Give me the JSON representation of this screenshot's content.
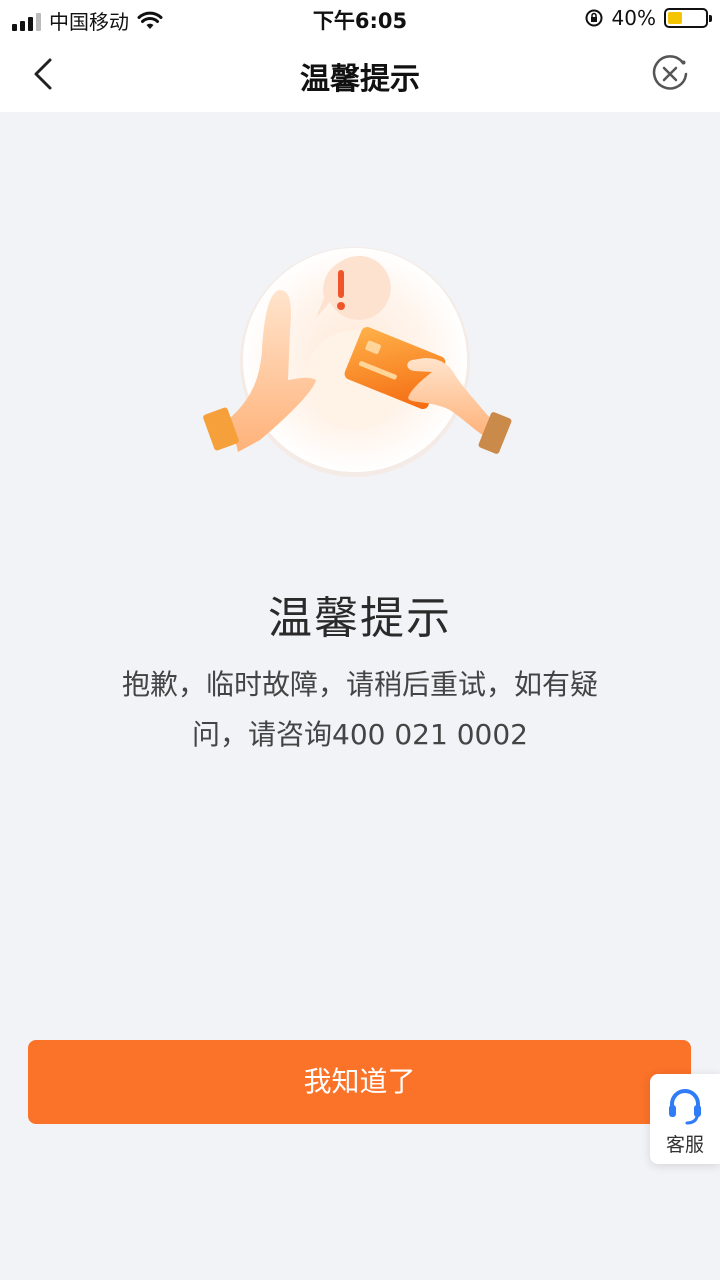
{
  "status_bar": {
    "carrier": "中国移动",
    "time": "下午6:05",
    "battery": "40%",
    "battery_level": 0.4
  },
  "nav": {
    "title": "温馨提示",
    "back_icon": "chevron-left-icon",
    "close_icon": "close-circle-icon"
  },
  "content": {
    "title": "温馨提示",
    "message_line1": "抱歉，临时故障，请稍后重试，如有疑",
    "message_line2": "问，请咨询400 021 0002"
  },
  "actions": {
    "confirm_label": "我知道了"
  },
  "service": {
    "label": "客服",
    "icon": "headset-icon"
  },
  "colors": {
    "accent": "#fb7229",
    "background": "#f2f3f7",
    "service_icon": "#2f7cf6"
  }
}
